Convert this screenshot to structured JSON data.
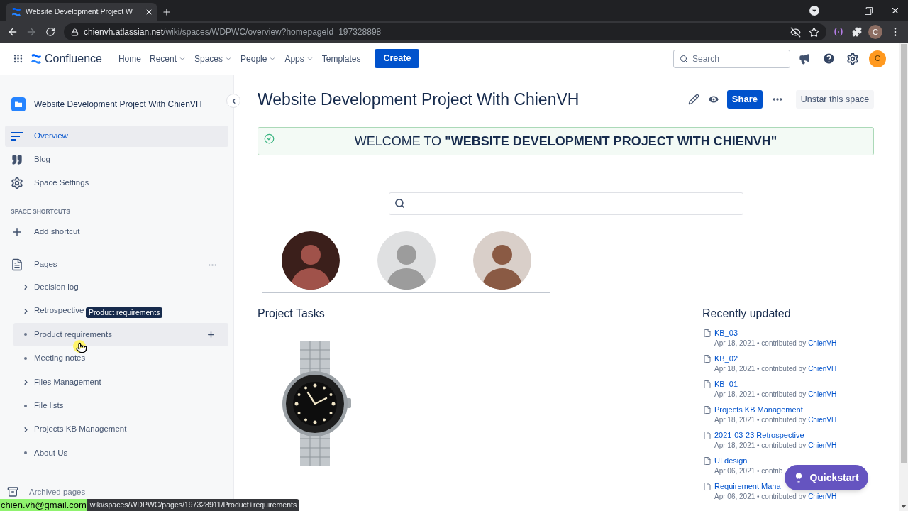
{
  "browser": {
    "tab": {
      "title": "Website Development Project W"
    },
    "forward_disabled": true,
    "address": {
      "host": "chienvh.atlassian.net",
      "path": "/wiki/spaces/WDPWC/overview?homepageId=197328898"
    },
    "profile_initial": "C"
  },
  "header": {
    "product": "Confluence",
    "nav": [
      {
        "label": "Home",
        "dropdown": false
      },
      {
        "label": "Recent",
        "dropdown": true
      },
      {
        "label": "Spaces",
        "dropdown": true
      },
      {
        "label": "People",
        "dropdown": true
      },
      {
        "label": "Apps",
        "dropdown": true
      },
      {
        "label": "Templates",
        "dropdown": false
      }
    ],
    "create_button": "Create",
    "search": {
      "placeholder": "Search"
    },
    "avatar_initial": "C"
  },
  "sidebar": {
    "space_name": "Website Development Project With ChienVH",
    "items": [
      {
        "kind": "overview",
        "label": "Overview",
        "selected": true
      },
      {
        "kind": "blog",
        "label": "Blog",
        "selected": false
      },
      {
        "kind": "settings",
        "label": "Space Settings",
        "selected": false
      }
    ],
    "shortcuts_heading": "SPACE SHORTCUTS",
    "add_shortcut": "Add shortcut",
    "pages_label": "Pages",
    "pages": [
      {
        "label": "Decision log",
        "kind": "parent",
        "hovered": false
      },
      {
        "label": "Retrospective",
        "kind": "parent",
        "hovered": false
      },
      {
        "label": "Product requirements",
        "kind": "leaf",
        "hovered": true
      },
      {
        "label": "Meeting notes",
        "kind": "leaf",
        "hovered": false
      },
      {
        "label": "Files Management",
        "kind": "parent",
        "hovered": false
      },
      {
        "label": "File lists",
        "kind": "leaf",
        "hovered": false
      },
      {
        "label": "Projects KB Management",
        "kind": "parent",
        "hovered": false
      },
      {
        "label": "About Us",
        "kind": "leaf",
        "hovered": false
      }
    ],
    "tooltip": "Product requirements",
    "archived": "Archived pages"
  },
  "page": {
    "title": "Website Development Project With ChienVH",
    "share_button": "Share",
    "unstar_button": "Unstar this space",
    "banner": "WELCOME TO **\"WEBSITE DEVELOPMENT PROJECT WITH CHIENVH\"**",
    "tasks_heading": "Project Tasks",
    "recent": {
      "heading": "Recently updated",
      "items": [
        {
          "title": "KB_03",
          "meta": "Apr 18, 2021 • contributed by",
          "author": "ChienVH"
        },
        {
          "title": "KB_02",
          "meta": "Apr 18, 2021 • contributed by",
          "author": "ChienVH"
        },
        {
          "title": "KB_01",
          "meta": "Apr 18, 2021 • contributed by",
          "author": "ChienVH"
        },
        {
          "title": "Projects KB Management",
          "meta": "Apr 18, 2021 • contributed by",
          "author": "ChienVH"
        },
        {
          "title": "2021-03-23 Retrospective",
          "meta": "Apr 18, 2021 • contributed by",
          "author": "ChienVH"
        },
        {
          "title": "UI design",
          "meta": "Apr 06, 2021 • contrib"
        },
        {
          "title": "Requirement Mana",
          "meta": "Apr 06, 2021 • contributed by",
          "author": "ChienVH"
        }
      ]
    },
    "quickstart_button": "Quickstart"
  },
  "status_overlay": {
    "email": "chien.vh@gmail.com",
    "link_preview": "wiki/spaces/WDPWC/pages/197328911/Product+requirements"
  }
}
